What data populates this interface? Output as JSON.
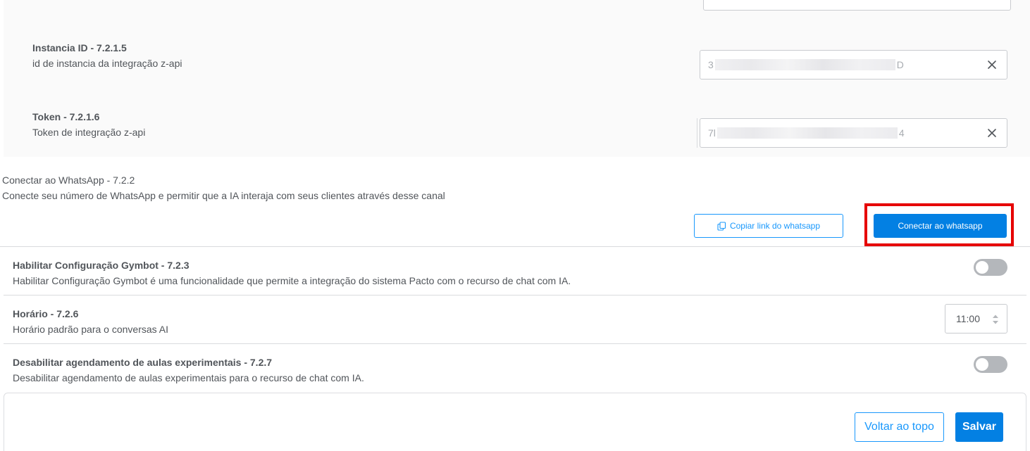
{
  "zapi": {
    "instance": {
      "title": "Instancia ID - 7.2.1.5",
      "description": "id de instancia da integração z-api",
      "value_prefix": "3",
      "value_suffix": "D"
    },
    "token": {
      "title": "Token - 7.2.1.6",
      "description": "Token de integração z-api",
      "value_prefix": "7l",
      "value_suffix": "4"
    }
  },
  "whatsapp": {
    "title": "Conectar ao WhatsApp - 7.2.2",
    "description": "Conecte seu número de WhatsApp e permitir que a IA interaja com seus clientes através desse canal",
    "copy_link_label": "Copiar link do whatsapp",
    "connect_label": "Conectar ao whatsapp"
  },
  "gymbot": {
    "title": "Habilitar Configuração Gymbot - 7.2.3",
    "description": "Habilitar Configuração Gymbot é uma funcionalidade que permite a integração do sistema Pacto com o recurso de chat com IA.",
    "enabled": false
  },
  "horario": {
    "title": "Horário - 7.2.6",
    "description": "Horário padrão para o conversas AI",
    "value": "11:00"
  },
  "experimental": {
    "title": "Desabilitar agendamento de aulas experimentais - 7.2.7",
    "description": "Desabilitar agendamento de aulas experimentais para o recurso de chat com IA.",
    "enabled": false
  },
  "footer": {
    "back_label": "Voltar ao topo",
    "save_label": "Salvar"
  },
  "colors": {
    "primary": "#0380e3",
    "outline": "#1998fc",
    "highlight": "#e60000"
  }
}
